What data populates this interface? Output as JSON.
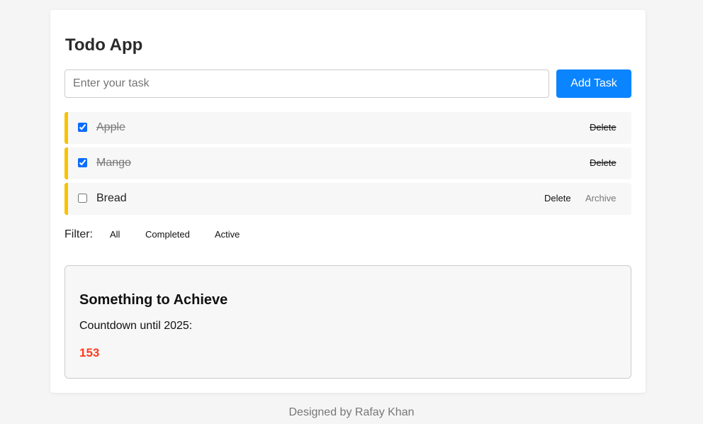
{
  "app": {
    "title": "Todo App"
  },
  "input": {
    "placeholder": "Enter your task",
    "value": ""
  },
  "add_button": {
    "label": "Add Task"
  },
  "tasks": [
    {
      "label": "Apple",
      "completed": true,
      "delete_label": "Delete"
    },
    {
      "label": "Mango",
      "completed": true,
      "delete_label": "Delete"
    },
    {
      "label": "Bread",
      "completed": false,
      "delete_label": "Delete",
      "archive_label": "Archive"
    }
  ],
  "filter": {
    "label": "Filter:",
    "options": [
      "All",
      "Completed",
      "Active"
    ]
  },
  "countdown": {
    "heading": "Something to Achieve",
    "text": "Countdown until 2025:",
    "value": "153"
  },
  "footer": {
    "text": "Designed by Rafay Khan"
  },
  "colors": {
    "accent": "#0a84ff",
    "task_border": "#f7c200",
    "countdown_value": "#ff3b1f"
  }
}
